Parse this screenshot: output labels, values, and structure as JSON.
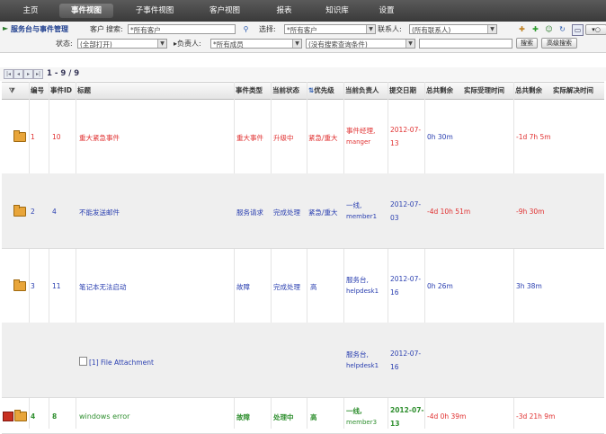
{
  "nav": {
    "tabs": [
      {
        "label": "主页"
      },
      {
        "label": "事件视图"
      },
      {
        "label": "子事件视图"
      },
      {
        "label": "客户视图"
      },
      {
        "label": "报表"
      },
      {
        "label": "知识库"
      },
      {
        "label": "设置"
      }
    ]
  },
  "filters": {
    "module_title": "服务台与事件管理",
    "customer_label": "客户",
    "search_label": "搜索:",
    "customer_value": "*所有客户",
    "choose_label": "选择:",
    "choose_value": "*所有客户",
    "contact_label": "联系人:",
    "contact_value": "(所有联系人)",
    "status_label": "状态:",
    "status_value": "(全部打开)",
    "owner_label": "负责人:",
    "owner_value": "*所有成员",
    "query_value": "(没有搜索查询条件)",
    "search_button": "搜索",
    "advanced_button": "高级搜索"
  },
  "pager": {
    "range": "1 - 9 / 9"
  },
  "table": {
    "headers": [
      "编号",
      "事件ID",
      "标题",
      "事件类型",
      "当前状态",
      "优先级",
      "当前负责人",
      "提交日期",
      "总共剩余",
      "实际受理时间",
      "总共剩余",
      "实际解决时间"
    ],
    "rows": [
      {
        "no": "1",
        "id": "10",
        "title": "重大紧急事件",
        "type": "重大事件",
        "status": "升级中",
        "priority": "紧急/重大",
        "owner": "事件经理,",
        "owner_user": "manger",
        "date1": "2012-07-",
        "date2": "13",
        "accept": "0h 30m",
        "resolve": "-1d 7h 5m",
        "color": "red"
      },
      {
        "no": "2",
        "id": "4",
        "title": "不能发送邮件",
        "type": "服务请求",
        "status": "完成处理",
        "priority": "紧急/重大",
        "owner": "一线,",
        "owner_user": "member1",
        "date1": "2012-07-",
        "date2": "03",
        "accept": "-4d 10h 51m",
        "resolve": "-9h 30m",
        "color": "blue"
      },
      {
        "no": "3",
        "id": "11",
        "title": "笔记本无法启动",
        "type": "故障",
        "status": "完成处理",
        "priority": "高",
        "owner": "服务台,",
        "owner_user": "helpdesk1",
        "date1": "2012-07-",
        "date2": "16",
        "accept": "0h 26m",
        "resolve": "3h 38m",
        "color": "blue"
      },
      {
        "attachment": "[1] File Attachment",
        "owner": "服务台,",
        "owner_user": "helpdesk1",
        "date1": "2012-07-",
        "date2": "16"
      },
      {
        "no": "4",
        "id": "8",
        "title": "windows error",
        "type": "故障",
        "status": "处理中",
        "priority": "高",
        "owner": "一线,",
        "owner_user": "member3",
        "date1": "2012-07-",
        "date2": "13",
        "accept": "-4d 0h 39m",
        "resolve": "-3d 21h 9m",
        "color": "green"
      }
    ]
  }
}
